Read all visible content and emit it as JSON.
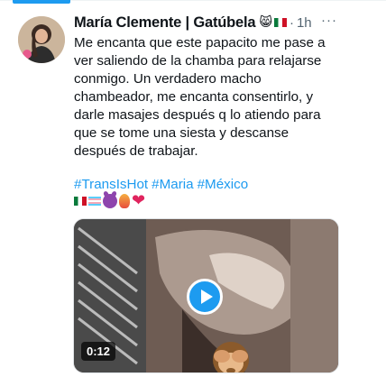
{
  "tweet": {
    "author_name": "María Clemente | Gatúbela",
    "author_emojis": "😸",
    "separator": "·",
    "time": "1h",
    "more": "···",
    "text": "Me encanta que este papacito me pase a ver saliendo de la chamba para relajarse conmigo. Un verdadero macho chambeador, me encanta consentirlo, y darle masajes después q lo atiendo para que se tome una siesta y descanse después de trabajar.",
    "hashtags": [
      "#TransIsHot",
      "#Maria",
      "#México"
    ],
    "emoji_icons": [
      "mexico-flag-icon",
      "trans-flag-icon",
      "devil-icon",
      "fire-icon",
      "heart-icon"
    ],
    "heart_glyph": "❤",
    "video": {
      "duration": "0:12",
      "overlay_emoji": "see-no-evil-monkey-icon"
    }
  },
  "colors": {
    "accent": "#1d9bf0",
    "text": "#0f1419",
    "muted": "#536471"
  }
}
